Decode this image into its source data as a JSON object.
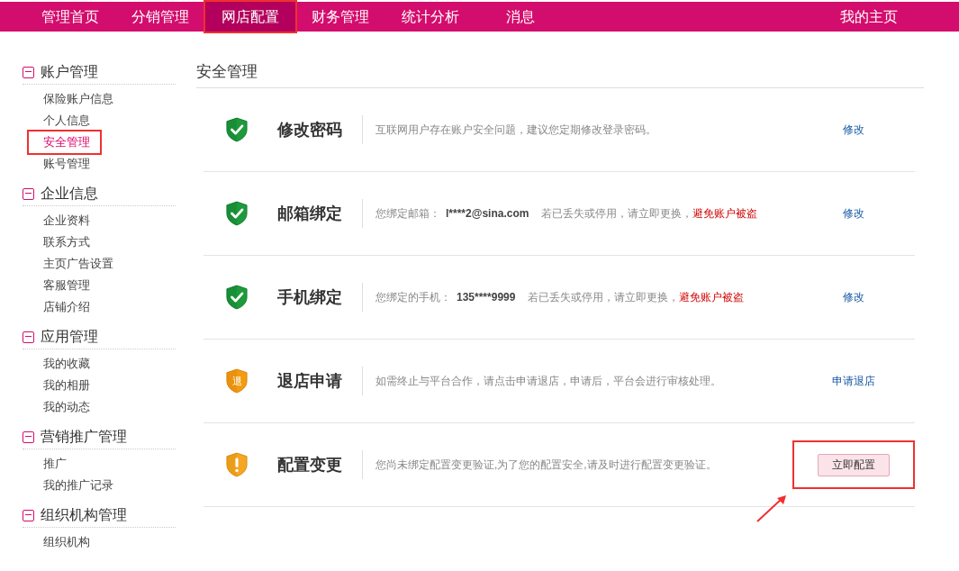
{
  "nav": {
    "items": [
      {
        "label": "管理首页",
        "selected": false,
        "highlighted": false
      },
      {
        "label": "分销管理",
        "selected": false,
        "highlighted": false
      },
      {
        "label": "网店配置",
        "selected": true,
        "highlighted": true
      },
      {
        "label": "财务管理",
        "selected": false,
        "highlighted": false
      },
      {
        "label": "统计分析",
        "selected": false,
        "highlighted": false
      },
      {
        "label": "消息",
        "selected": false,
        "highlighted": false
      }
    ],
    "right_link": "我的主页"
  },
  "sidebar": {
    "groups": [
      {
        "title": "账户管理",
        "expanded": true,
        "items": [
          {
            "label": "保险账户信息",
            "selected": false,
            "highlighted": false
          },
          {
            "label": "个人信息",
            "selected": false,
            "highlighted": false
          },
          {
            "label": "安全管理",
            "selected": true,
            "highlighted": true
          },
          {
            "label": "账号管理",
            "selected": false,
            "highlighted": false
          }
        ]
      },
      {
        "title": "企业信息",
        "expanded": true,
        "items": [
          {
            "label": "企业资料",
            "selected": false,
            "highlighted": false
          },
          {
            "label": "联系方式",
            "selected": false,
            "highlighted": false
          },
          {
            "label": "主页广告设置",
            "selected": false,
            "highlighted": false
          },
          {
            "label": "客服管理",
            "selected": false,
            "highlighted": false
          },
          {
            "label": "店铺介绍",
            "selected": false,
            "highlighted": false
          }
        ]
      },
      {
        "title": "应用管理",
        "expanded": true,
        "items": [
          {
            "label": "我的收藏",
            "selected": false,
            "highlighted": false
          },
          {
            "label": "我的相册",
            "selected": false,
            "highlighted": false
          },
          {
            "label": "我的动态",
            "selected": false,
            "highlighted": false
          }
        ]
      },
      {
        "title": "营销推广管理",
        "expanded": true,
        "items": [
          {
            "label": "推广",
            "selected": false,
            "highlighted": false
          },
          {
            "label": "我的推广记录",
            "selected": false,
            "highlighted": false
          }
        ]
      },
      {
        "title": "组织机构管理",
        "expanded": true,
        "items": [
          {
            "label": "组织机构",
            "selected": false,
            "highlighted": false
          }
        ]
      }
    ]
  },
  "main": {
    "title": "安全管理",
    "rows": [
      {
        "kind": "check",
        "title": "修改密码",
        "description": "互联网用户存在账户安全问题，建议您定期修改登录密码。",
        "action": {
          "kind": "link",
          "label": "修改",
          "highlighted": false
        }
      },
      {
        "kind": "check",
        "title": "邮箱绑定",
        "description": "您绑定邮箱：",
        "value": "l****2@sina.com",
        "description_end": "若已丢失或停用，请立即更换，",
        "warning": "避免账户被盗",
        "action": {
          "kind": "link",
          "label": "修改",
          "highlighted": false
        }
      },
      {
        "kind": "check",
        "title": "手机绑定",
        "description": "您绑定的手机：",
        "value": "135****9999",
        "description_end": "若已丢失或停用，请立即更换，",
        "warning": "避免账户被盗",
        "action": {
          "kind": "link",
          "label": "修改",
          "highlighted": false
        }
      },
      {
        "kind": "text",
        "icon_text": "退",
        "title": "退店申请",
        "description": "如需终止与平台合作，请点击申请退店，申请后，平台会进行审核处理。",
        "action": {
          "kind": "link",
          "label": "申请退店",
          "highlighted": false
        }
      },
      {
        "kind": "exclaim",
        "title": "配置变更",
        "description": "您尚未绑定配置变更验证,为了您的配置安全,请及时进行配置变更验证。",
        "action": {
          "kind": "button",
          "label": "立即配置",
          "highlighted": true
        }
      }
    ],
    "annotation_arrow": true
  }
}
